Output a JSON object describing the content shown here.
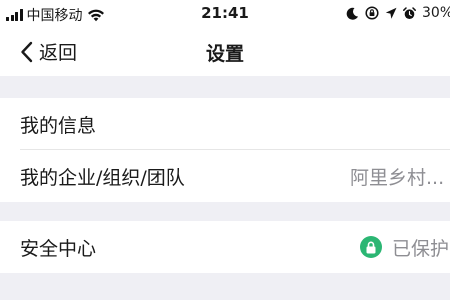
{
  "status_bar": {
    "carrier": "中国移动",
    "time": "21:41",
    "battery": "30%"
  },
  "nav": {
    "back_label": "返回",
    "title": "设置"
  },
  "sections": {
    "profile": {
      "my_info_label": "我的信息",
      "org_label": "我的企业/组织/团队",
      "org_value": "阿里乡村..."
    },
    "security": {
      "label": "安全中心",
      "status": "已保护"
    }
  },
  "colors": {
    "background": "#efeff4",
    "card": "#ffffff",
    "secondary_text": "#8e8e93",
    "protected_green": "#2bb673"
  },
  "icons": {
    "signal": "signal-icon",
    "wifi": "wifi-icon",
    "moon": "moon-icon",
    "orientation_lock": "orientation-lock-icon",
    "location": "location-icon",
    "alarm": "alarm-icon",
    "back": "chevron-left-icon",
    "lock": "lock-icon"
  }
}
